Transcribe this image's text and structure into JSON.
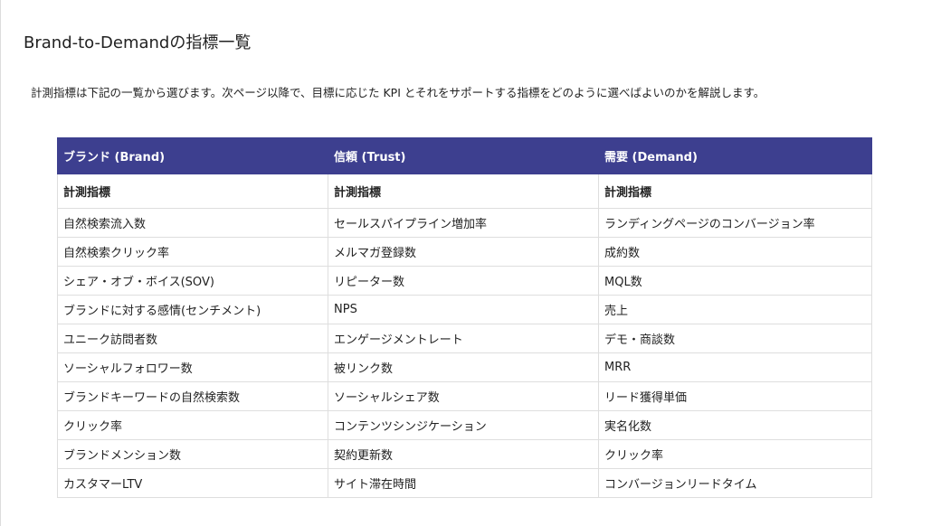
{
  "page": {
    "title": "Brand-to-Demandの指標一覧",
    "intro": "計測指標は下記の一覧から選びます。次ページ以降で、目標に応じた KPI とそれをサポートする指標をどのように選べばよいのかを解説します。"
  },
  "table": {
    "headers": [
      "ブランド (Brand)",
      "信頼 (Trust)",
      "需要 (Demand)"
    ],
    "subheaders": [
      "計測指標",
      "計測指標",
      "計測指標"
    ],
    "rows": [
      [
        "自然検索流入数",
        "セールスパイプライン増加率",
        "ランディングページのコンバージョン率"
      ],
      [
        "自然検索クリック率",
        "メルマガ登録数",
        "成約数"
      ],
      [
        "シェア・オブ・ボイス(SOV)",
        "リピーター数",
        "MQL数"
      ],
      [
        "ブランドに対する感情(センチメント)",
        "NPS",
        "売上"
      ],
      [
        "ユニーク訪問者数",
        "エンゲージメントレート",
        "デモ・商談数"
      ],
      [
        "ソーシャルフォロワー数",
        "被リンク数",
        "MRR"
      ],
      [
        "ブランドキーワードの自然検索数",
        "ソーシャルシェア数",
        "リード獲得単価"
      ],
      [
        "クリック率",
        "コンテンツシンジケーション",
        "実名化数"
      ],
      [
        "ブランドメンション数",
        "契約更新数",
        "クリック率"
      ],
      [
        "カスタマーLTV",
        "サイト滞在時間",
        "コンバージョンリードタイム"
      ]
    ]
  },
  "colors": {
    "header_bg": "#3d3f8f",
    "header_text": "#ffffff",
    "border": "#dedede"
  }
}
